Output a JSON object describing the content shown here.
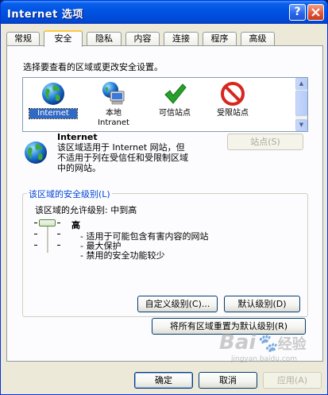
{
  "window": {
    "title": "Internet 选项",
    "help_label": "?"
  },
  "tabs": [
    {
      "label": "常规"
    },
    {
      "label": "安全"
    },
    {
      "label": "隐私"
    },
    {
      "label": "内容"
    },
    {
      "label": "连接"
    },
    {
      "label": "程序"
    },
    {
      "label": "高级"
    }
  ],
  "active_tab": "安全",
  "security": {
    "instruction": "选择要查看的区域或更改安全设置。",
    "zones": [
      {
        "label": "Internet",
        "icon": "globe-icon"
      },
      {
        "label": "本地\nIntranet",
        "icon": "intranet-computer-icon"
      },
      {
        "label": "可信站点",
        "icon": "checkmark-icon"
      },
      {
        "label": "受限站点",
        "icon": "no-entry-icon"
      }
    ],
    "selected_zone": {
      "name": "Internet",
      "description_line1": "该区域适用于 Internet 网站，但",
      "description_line2": "不适用于列在受信任和受限制区域",
      "description_line3": "中的网站。"
    },
    "sites_button": "站点(S)",
    "level_group": {
      "title": "该区域的安全级别(L)",
      "allowed_level": "该区域的允许级别: 中到高",
      "level": "高",
      "bullets": [
        "- 适用于可能包含有害内容的网站",
        "- 最大保护",
        "- 禁用的安全功能较少"
      ],
      "custom_button": "自定义级别(C)...",
      "default_button": "默认级别(D)"
    },
    "reset_all_button": "将所有区域重置为默认级别(R)"
  },
  "footer": {
    "ok_button": "确定",
    "cancel_button": "取消",
    "apply_button": "应用(A)"
  },
  "watermark": {
    "brand": "Bai",
    "brand2": "经验",
    "url": "jingyan.baidu.com"
  },
  "colors": {
    "titlebar": "#0053e1",
    "window_bg": "#ece9d8",
    "selection": "#316ac5",
    "group_title": "#0046d5"
  }
}
